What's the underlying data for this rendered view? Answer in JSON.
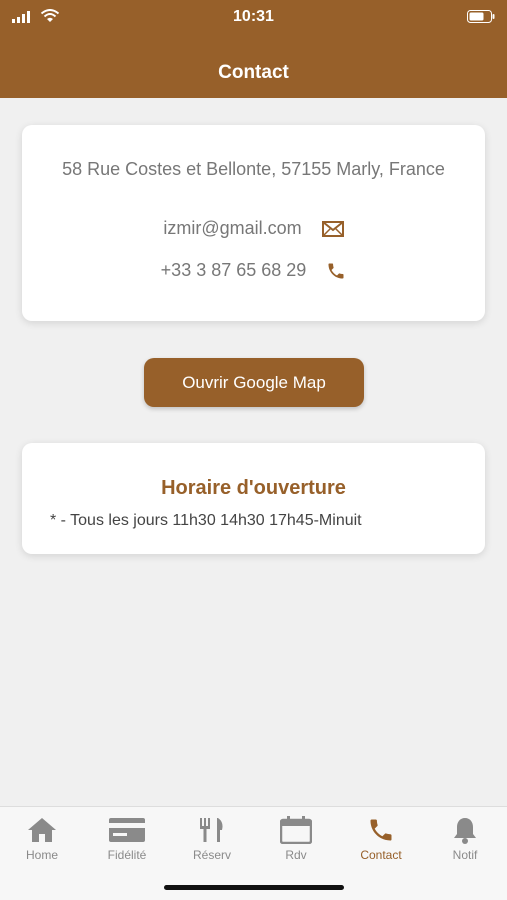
{
  "status_bar": {
    "time": "10:31"
  },
  "header": {
    "title": "Contact"
  },
  "contact": {
    "address": "58 Rue Costes et Bellonte, 57155 Marly, France",
    "email": "izmir@gmail.com",
    "phone": "+33 3 87 65 68 29",
    "email_icon": "envelope-icon",
    "phone_icon": "phone-icon"
  },
  "map_button": {
    "label": "Ouvrir Google Map"
  },
  "hours": {
    "title": "Horaire d'ouverture",
    "line": "* - Tous les jours 11h30 14h30 17h45-Minuit"
  },
  "tabs": [
    {
      "label": "Home",
      "icon": "home-icon",
      "active": false
    },
    {
      "label": "Fidélité",
      "icon": "card-icon",
      "active": false
    },
    {
      "label": "Réserv",
      "icon": "fork-knife-icon",
      "active": false
    },
    {
      "label": "Rdv",
      "icon": "calendar-icon",
      "active": false
    },
    {
      "label": "Contact",
      "icon": "phone-icon",
      "active": true
    },
    {
      "label": "Notif",
      "icon": "bell-icon",
      "active": false
    }
  ],
  "colors": {
    "brand": "#97602a",
    "background": "#f0f0f0",
    "tab_inactive": "#8a8a8a"
  }
}
